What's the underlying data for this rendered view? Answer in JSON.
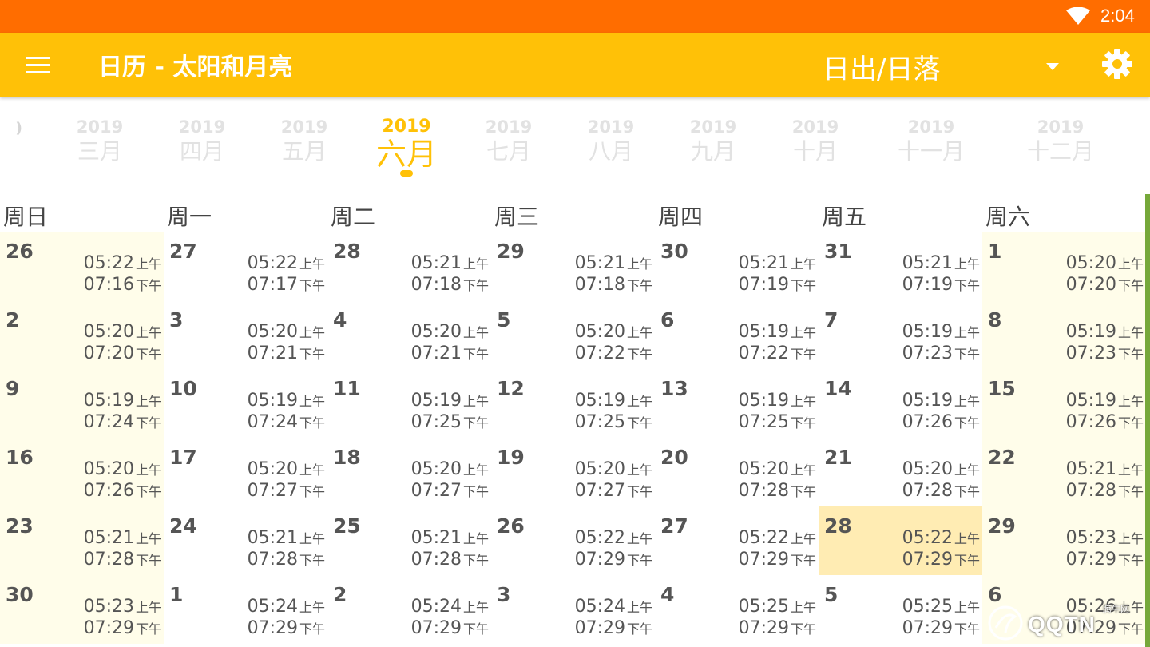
{
  "status_bar": {
    "time": "2:04"
  },
  "app_bar": {
    "title": "日历 - 太阳和月亮",
    "mode": "日出/日落"
  },
  "months": [
    {
      "year": "2019",
      "month": "三月"
    },
    {
      "year": "2019",
      "month": "四月"
    },
    {
      "year": "2019",
      "month": "五月"
    },
    {
      "year": "2019",
      "month": "六月",
      "active": true
    },
    {
      "year": "2019",
      "month": "七月"
    },
    {
      "year": "2019",
      "month": "八月"
    },
    {
      "year": "2019",
      "month": "九月"
    },
    {
      "year": "2019",
      "month": "十月"
    },
    {
      "year": "2019",
      "month": "十一月"
    },
    {
      "year": "2019",
      "month": "十二月"
    }
  ],
  "weekdays": [
    "周日",
    "周一",
    "周二",
    "周三",
    "周四",
    "周五",
    "周六"
  ],
  "am_label": "上午",
  "pm_label": "下午",
  "weeks": [
    [
      [
        "26",
        "05:22",
        "07:16"
      ],
      [
        "27",
        "05:22",
        "07:17"
      ],
      [
        "28",
        "05:21",
        "07:18"
      ],
      [
        "29",
        "05:21",
        "07:18"
      ],
      [
        "30",
        "05:21",
        "07:19"
      ],
      [
        "31",
        "05:21",
        "07:19"
      ],
      [
        "1",
        "05:20",
        "07:20"
      ]
    ],
    [
      [
        "2",
        "05:20",
        "07:20"
      ],
      [
        "3",
        "05:20",
        "07:21"
      ],
      [
        "4",
        "05:20",
        "07:21"
      ],
      [
        "5",
        "05:20",
        "07:22"
      ],
      [
        "6",
        "05:19",
        "07:22"
      ],
      [
        "7",
        "05:19",
        "07:23"
      ],
      [
        "8",
        "05:19",
        "07:23"
      ]
    ],
    [
      [
        "9",
        "05:19",
        "07:24"
      ],
      [
        "10",
        "05:19",
        "07:24"
      ],
      [
        "11",
        "05:19",
        "07:25"
      ],
      [
        "12",
        "05:19",
        "07:25"
      ],
      [
        "13",
        "05:19",
        "07:25"
      ],
      [
        "14",
        "05:19",
        "07:26"
      ],
      [
        "15",
        "05:19",
        "07:26"
      ]
    ],
    [
      [
        "16",
        "05:20",
        "07:26"
      ],
      [
        "17",
        "05:20",
        "07:27"
      ],
      [
        "18",
        "05:20",
        "07:27"
      ],
      [
        "19",
        "05:20",
        "07:27"
      ],
      [
        "20",
        "05:20",
        "07:28"
      ],
      [
        "21",
        "05:20",
        "07:28"
      ],
      [
        "22",
        "05:21",
        "07:28"
      ]
    ],
    [
      [
        "23",
        "05:21",
        "07:28"
      ],
      [
        "24",
        "05:21",
        "07:28"
      ],
      [
        "25",
        "05:21",
        "07:28"
      ],
      [
        "26",
        "05:22",
        "07:29"
      ],
      [
        "27",
        "05:22",
        "07:29"
      ],
      [
        "28",
        "05:22",
        "07:29"
      ],
      [
        "29",
        "05:23",
        "07:29"
      ]
    ],
    [
      [
        "30",
        "05:23",
        "07:29"
      ],
      [
        "1",
        "05:24",
        "07:29"
      ],
      [
        "2",
        "05:24",
        "07:29"
      ],
      [
        "3",
        "05:24",
        "07:29"
      ],
      [
        "4",
        "05:25",
        "07:29"
      ],
      [
        "5",
        "05:25",
        "07:29"
      ],
      [
        "6",
        "05:26",
        "07:29"
      ]
    ]
  ],
  "today": {
    "week": 4,
    "day": 5
  },
  "colors": {
    "status_bar": "#ff6d00",
    "app_bar": "#ffc107",
    "weekend_bg": "#fffdea",
    "today_bg": "#ffecb3"
  },
  "icons": {
    "menu": "menu-icon",
    "dropdown": "arrow-drop-down-icon",
    "settings": "gear-icon",
    "wifi": "wifi-icon"
  },
  "watermark": {
    "main": "QQTN",
    "small": "腾牛网"
  }
}
